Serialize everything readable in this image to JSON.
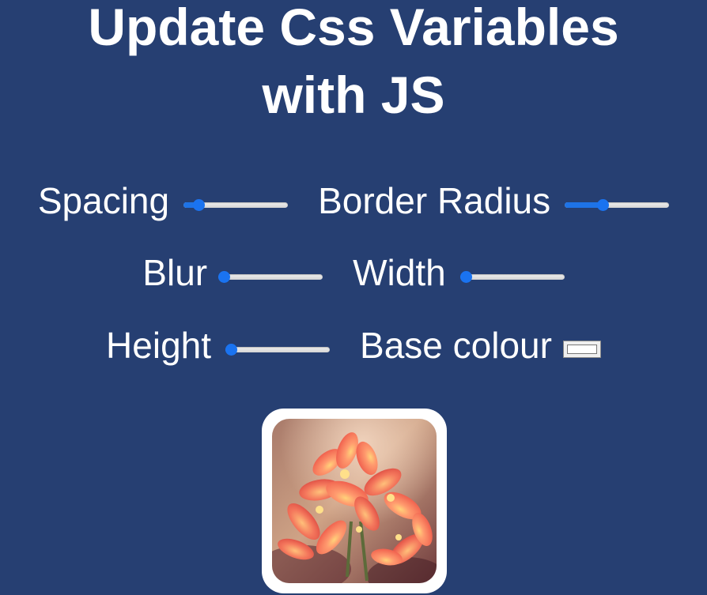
{
  "page": {
    "title_line1": "Update Css Variables",
    "title_line2": "with JS"
  },
  "controls": {
    "spacing": {
      "label": "Spacing",
      "value_fraction": 0.1
    },
    "border_radius": {
      "label": "Border Radius",
      "value_fraction": 0.35
    },
    "blur": {
      "label": "Blur",
      "value_fraction": 0.0
    },
    "width": {
      "label": "Width",
      "value_fraction": 0.0
    },
    "height": {
      "label": "Height",
      "value_fraction": 0.0
    },
    "base_colour": {
      "label": "Base colour",
      "value": "#ffffff"
    }
  },
  "image": {
    "subject": "flower-photo",
    "frame_color": "#ffffff"
  },
  "colors": {
    "background": "#263f72",
    "slider_accent": "#1a73f0"
  }
}
